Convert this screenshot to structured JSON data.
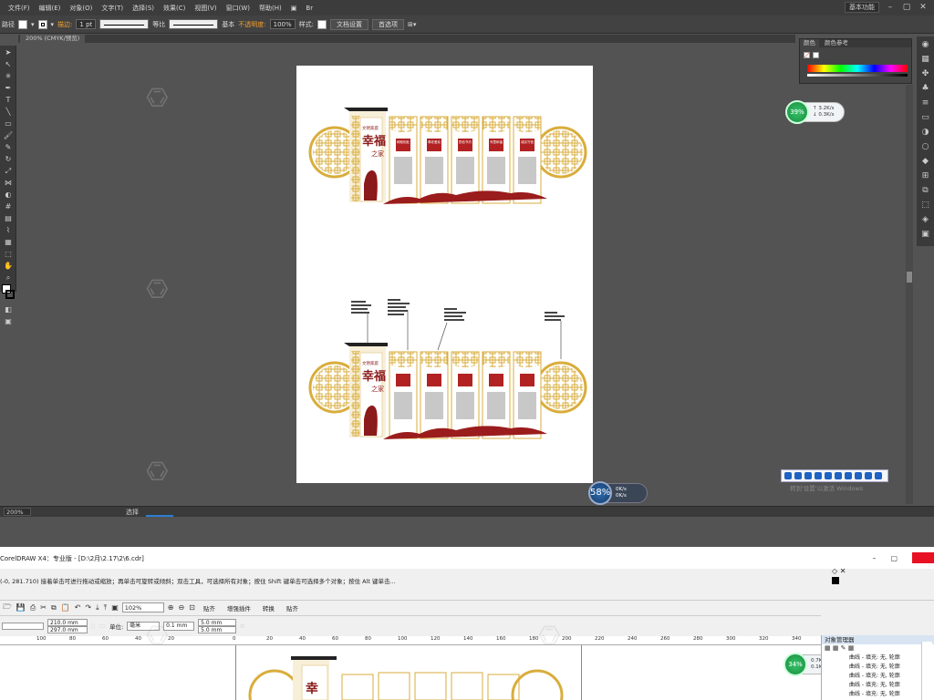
{
  "ai": {
    "menu": [
      "文件(F)",
      "编辑(E)",
      "对象(O)",
      "文字(T)",
      "选择(S)",
      "效果(C)",
      "视图(V)",
      "窗口(W)",
      "帮助(H)"
    ],
    "br_icon": "Br",
    "workspace": "基本功能",
    "control": {
      "label": "路径",
      "stroke_label": "描边:",
      "stroke_val": "1 pt",
      "uniform": "等比",
      "basic": "基本",
      "opacity_label": "不透明度:",
      "opacity_val": "100%",
      "style_label": "样式:",
      "doc_setup": "文档设置",
      "prefs": "首选项"
    },
    "tab": "200% (CMYK/预览)",
    "color_tabs": [
      "颜色",
      "颜色参考"
    ],
    "status": {
      "zoom": "200%",
      "sel": "选择"
    },
    "speed_top": {
      "pct": "39%",
      "up": "3.2K/s",
      "down": "0.3K/s"
    },
    "speed_bottom": {
      "pct": "58%",
      "up": "0K/s",
      "down": "0K/s"
    },
    "activate": "转到'设置'以激活 Windows"
  },
  "artwork": {
    "subtitle": "文明家庭",
    "title1": "幸福",
    "title2": "之家",
    "panel_heads": [
      "和睦相处",
      "尊老爱幼",
      "勤俭节约",
      "邻里和谐",
      "诚实守信"
    ]
  },
  "corel": {
    "title": "CorelDRAW X4：专业版 - [D:\\2月\\2.17\\2\\6.cdr]",
    "coords": "(-0, 281.710)",
    "hint": "接着单击可进行拖动或缩放；再单击可旋转或倾斜；双击工具，可选择所有对象；按住 Shift 键单击可选择多个对象；按住 Alt 键单击...",
    "zoom": "102%",
    "buttons": [
      "贴齐",
      "增强插件",
      "转换",
      "贴齐"
    ],
    "w": "210.0 mm",
    "h": "297.0 mm",
    "unit_label": "单位:",
    "unit": "毫米",
    "nudge": "0.1 mm",
    "dup_x": "5.0 mm",
    "dup_y": "5.0 mm",
    "ruler": [
      "100",
      "80",
      "60",
      "40",
      "20",
      "0",
      "20",
      "40",
      "60",
      "80",
      "100",
      "120",
      "140",
      "160",
      "180",
      "200",
      "220",
      "240",
      "260",
      "280",
      "300",
      "320",
      "340"
    ],
    "obj_panel_title": "对象管理器",
    "obj_rows": [
      "曲线 - 填充: 无, 轮廓",
      "曲线 - 填充: 无, 轮廓",
      "曲线 - 填充: 无, 轮廓",
      "曲线 - 填充: 无, 轮廓",
      "曲线 - 填充: 无, 轮廓"
    ],
    "speed": {
      "pct": "34%",
      "up": "0.7K/s",
      "down": "0.1K/s"
    }
  }
}
